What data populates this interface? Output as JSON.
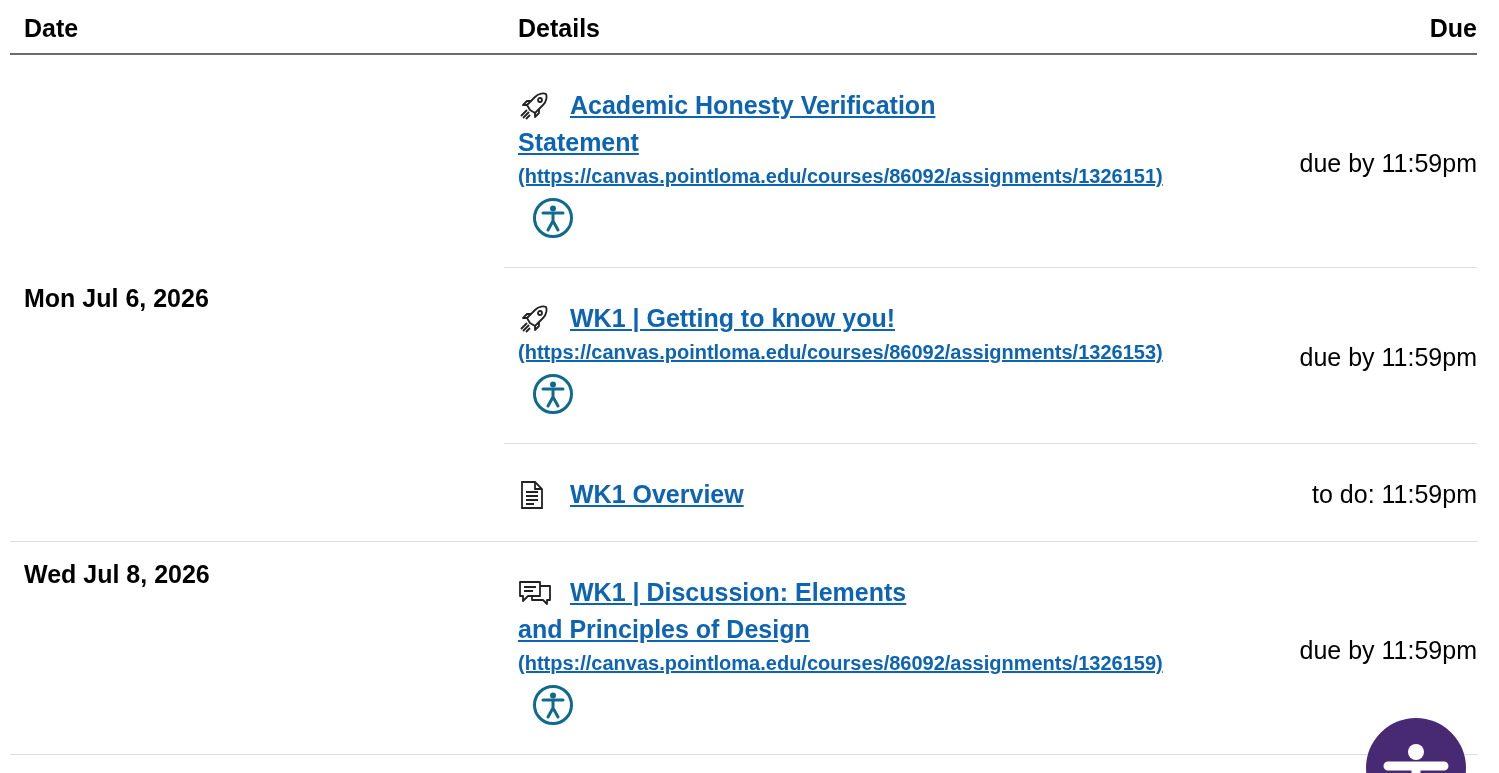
{
  "table": {
    "columns": [
      "Date",
      "Details",
      "Due"
    ],
    "groups": [
      {
        "date": "Mon Jul 6, 2026",
        "items": [
          {
            "kind": "assignment",
            "title": "Academic Honesty Verification Statement",
            "url": "(https://canvas.pointloma.edu/courses/86092/assignments/1326151)",
            "due": "due by 11:59pm",
            "accessibility_badge": true
          },
          {
            "kind": "assignment",
            "title": "WK1 | Getting to know you!",
            "url": "(https://canvas.pointloma.edu/courses/86092/assignments/1326153)",
            "due": "due by 11:59pm",
            "accessibility_badge": true
          },
          {
            "kind": "page",
            "title": "WK1 Overview",
            "due": "to do: 11:59pm",
            "accessibility_badge": false
          }
        ]
      },
      {
        "date": "Wed Jul 8, 2026",
        "items": [
          {
            "kind": "discussion",
            "title": "WK1 | Discussion: Elements and Principles of Design",
            "url": "(https://canvas.pointloma.edu/courses/86092/assignments/1326159)",
            "due": "due by 11:59pm",
            "accessibility_badge": true
          }
        ]
      }
    ]
  },
  "accessibility_button": true
}
